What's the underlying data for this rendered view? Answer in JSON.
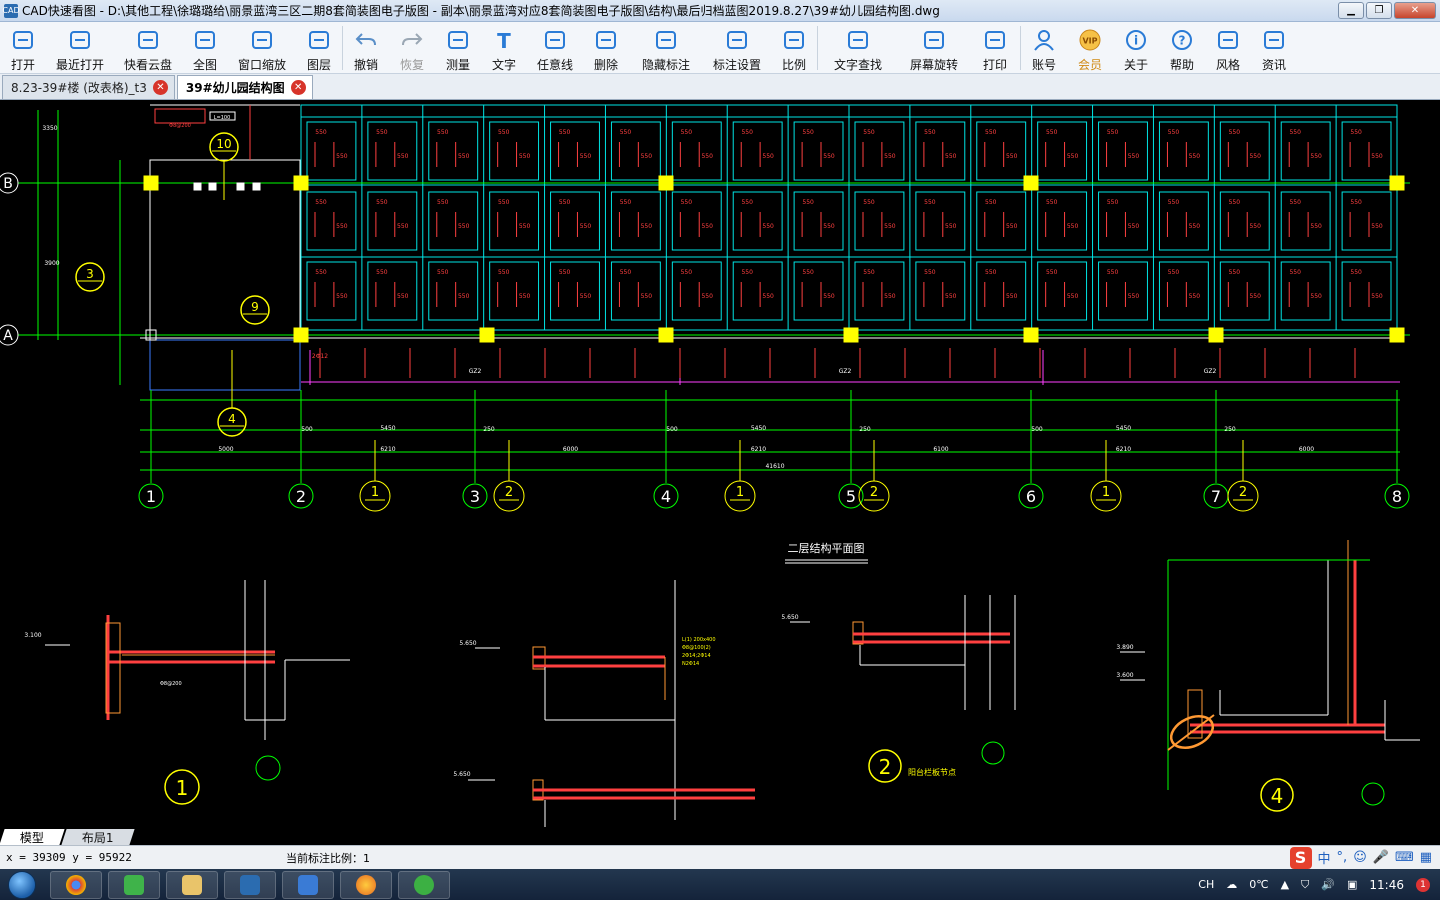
{
  "window": {
    "app_icon": "CAD",
    "title": "CAD快速看图 - D:\\其他工程\\徐璐璐给\\丽景蓝湾三区二期8套简装图电子版图 - 副本\\丽景蓝湾对应8套简装图电子版图\\结构\\最后归档蓝图2019.8.27\\39#幼儿园结构图.dwg"
  },
  "toolbar": [
    {
      "label": "打开",
      "icon": "folder-open-icon"
    },
    {
      "label": "最近打开",
      "icon": "recent-icon"
    },
    {
      "label": "快看云盘",
      "icon": "cloud-icon"
    },
    {
      "label": "全图",
      "icon": "fit-all-icon"
    },
    {
      "label": "窗口缩放",
      "icon": "zoom-window-icon"
    },
    {
      "label": "图层",
      "icon": "layers-icon"
    },
    {
      "label": "撤销",
      "icon": "undo-icon"
    },
    {
      "label": "恢复",
      "icon": "redo-icon"
    },
    {
      "label": "测量",
      "icon": "measure-icon"
    },
    {
      "label": "文字",
      "icon": "text-icon"
    },
    {
      "label": "任意线",
      "icon": "pen-icon"
    },
    {
      "label": "删除",
      "icon": "eraser-icon"
    },
    {
      "label": "隐藏标注",
      "icon": "eye-hide-icon"
    },
    {
      "label": "标注设置",
      "icon": "annotation-settings-icon"
    },
    {
      "label": "比例",
      "icon": "scale-icon"
    },
    {
      "label": "文字查找",
      "icon": "text-search-icon"
    },
    {
      "label": "屏幕旋转",
      "icon": "rotate-screen-icon"
    },
    {
      "label": "打印",
      "icon": "print-icon"
    },
    {
      "label": "账号",
      "icon": "account-icon"
    },
    {
      "label": "会员",
      "icon": "vip-icon"
    },
    {
      "label": "关于",
      "icon": "info-icon"
    },
    {
      "label": "帮助",
      "icon": "help-icon"
    },
    {
      "label": "风格",
      "icon": "style-icon"
    },
    {
      "label": "资讯",
      "icon": "news-icon"
    }
  ],
  "tabs": [
    {
      "label": "8.23-39#楼 (改表格)_t3"
    },
    {
      "label": "39#幼儿园结构图"
    }
  ],
  "drawing": {
    "grid_rows": [
      "B",
      "A"
    ],
    "grid_cols": [
      "1",
      "2",
      "3",
      "4",
      "5",
      "6",
      "7",
      "8"
    ],
    "sub_axes": [
      "1",
      "2",
      "1",
      "2",
      "1",
      "2",
      "1",
      "2"
    ],
    "plan_title": "二层结构平面图",
    "detail_markers": [
      "1",
      "2",
      "4"
    ],
    "detail_label_2": "阳台栏板节点",
    "overall_dimension": "41610",
    "span_dimensions": [
      "5000",
      "6210",
      "6000",
      "6210",
      "6100",
      "6210",
      "6000"
    ],
    "sub_dimensions": [
      "500",
      "5450",
      "250"
    ],
    "elevations": [
      "3.100",
      "5.650",
      "5.650",
      "3.890",
      "3.890",
      "3.600"
    ],
    "cell_labels": [
      "550",
      "550"
    ],
    "rebar_label": "Φ8@200",
    "beam_label": "2Φ12",
    "column_label": "GZ2",
    "callouts": [
      "10",
      "3",
      "9",
      "4"
    ],
    "note_small": "L=100",
    "beam_spec": [
      "L(1)  200x400",
      "Φ8@100(2)",
      "2Φ14;2Φ14",
      "N2Φ14"
    ]
  },
  "layout_tabs": [
    "模型",
    "布局1"
  ],
  "status": {
    "coords": "x = 39309  y = 95922",
    "scale": "当前标注比例：1"
  },
  "ime": {
    "logo": "S",
    "mode": "中"
  },
  "tray": {
    "lang": "CH",
    "weather": "0℃",
    "time": "11:46",
    "badge": "1"
  }
}
